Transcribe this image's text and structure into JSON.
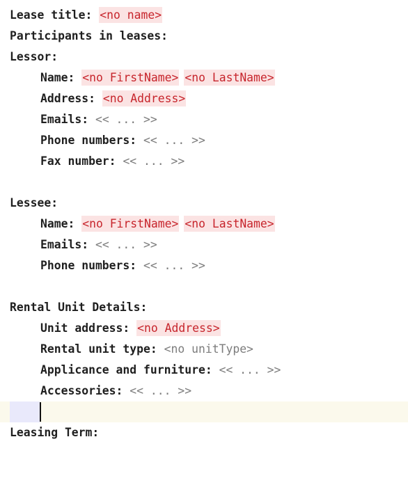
{
  "lease": {
    "title_label": "Lease title:",
    "title_value": "<no name>",
    "participants_label": "Participants in leases:"
  },
  "lessor": {
    "heading": "Lessor:",
    "name_label": "Name:",
    "first_name": "<no FirstName>",
    "last_name": "<no LastName>",
    "address_label": "Address:",
    "address_value": "<no Address>",
    "emails_label": "Emails:",
    "emails_value": "<< ... >>",
    "phones_label": "Phone numbers:",
    "phones_value": "<< ... >>",
    "fax_label": "Fax number:",
    "fax_value": "<< ... >>"
  },
  "lessee": {
    "heading": "Lessee:",
    "name_label": "Name:",
    "first_name": "<no FirstName>",
    "last_name": "<no LastName>",
    "emails_label": "Emails:",
    "emails_value": "<< ... >>",
    "phones_label": "Phone numbers:",
    "phones_value": "<< ... >>"
  },
  "rental_unit": {
    "heading": "Rental Unit Details:",
    "address_label": "Unit address:",
    "address_value": "<no Address>",
    "type_label": "Rental unit type:",
    "type_value": "<no unitType>",
    "appliances_label": "Applicance and furniture:",
    "appliances_value": "<< ... >>",
    "accessories_label": "Accessories:",
    "accessories_value": "<< ... >>"
  },
  "leasing_term": {
    "heading": "Leasing Term:"
  }
}
